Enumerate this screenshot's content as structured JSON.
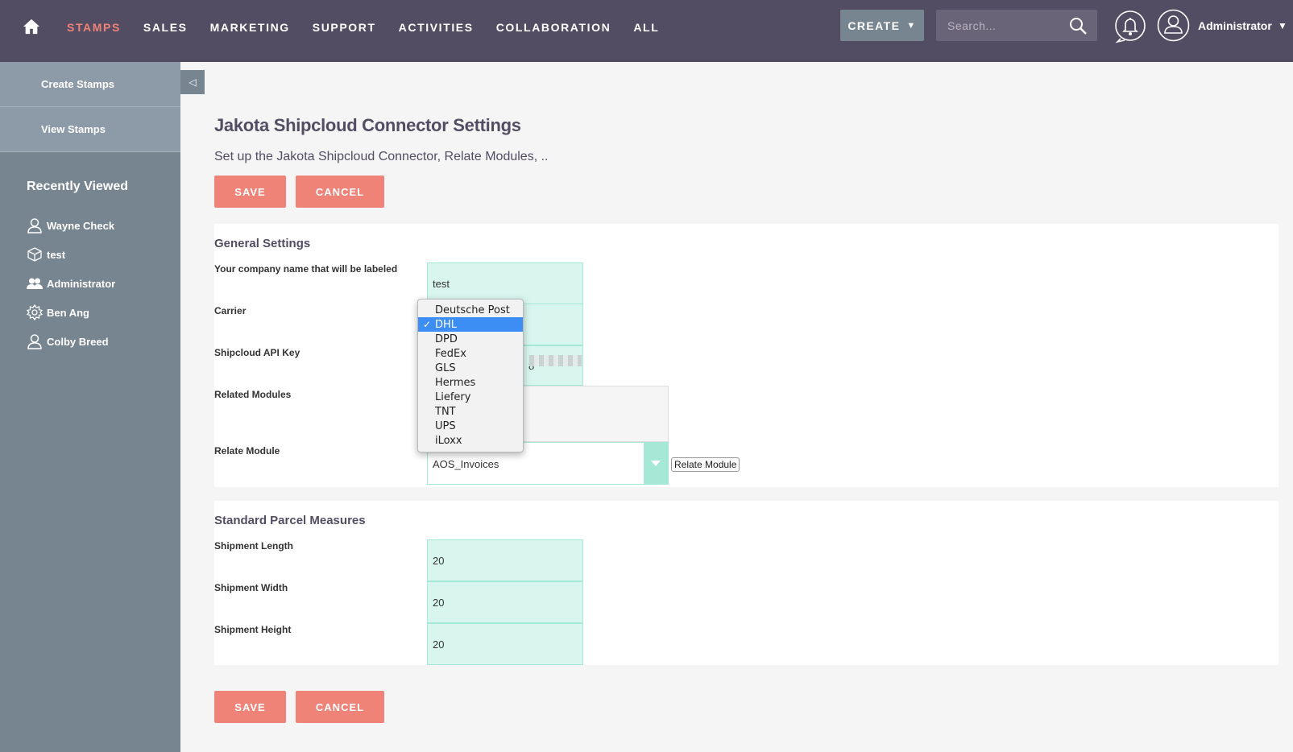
{
  "nav": {
    "links": [
      "STAMPS",
      "SALES",
      "MARKETING",
      "SUPPORT",
      "ACTIVITIES",
      "COLLABORATION",
      "ALL"
    ],
    "create_label": "CREATE",
    "search_placeholder": "Search...",
    "user_name": "Administrator"
  },
  "sidebar": {
    "actions": [
      "Create Stamps",
      "View Stamps"
    ],
    "recent_title": "Recently Viewed",
    "recent_items": [
      {
        "label": "Wayne Check",
        "icon": "contact-icon"
      },
      {
        "label": "test",
        "icon": "cube-icon"
      },
      {
        "label": "Administrator",
        "icon": "users-icon"
      },
      {
        "label": "Ben Ang",
        "icon": "gear-icon"
      },
      {
        "label": "Colby Breed",
        "icon": "contact-icon"
      }
    ]
  },
  "page": {
    "title": "Jakota Shipcloud Connector Settings",
    "subtitle": "Set up the Jakota Shipcloud Connector, Relate Modules, ..",
    "save_label": "SAVE",
    "cancel_label": "CANCEL"
  },
  "general": {
    "title": "General Settings",
    "company_label": "Your company name that will be labeled",
    "company_value": "test",
    "carrier_label": "Carrier",
    "api_key_label": "Shipcloud API Key",
    "api_key_visible": "8",
    "related_modules_label": "Related Modules",
    "relate_module_label": "Relate Module",
    "relate_module_value": "AOS_Invoices",
    "relate_module_button": "Relate Module"
  },
  "carrier_dropdown": {
    "options": [
      "Deutsche Post",
      "DHL",
      "DPD",
      "FedEx",
      "GLS",
      "Hermes",
      "Liefery",
      "TNT",
      "UPS",
      "iLoxx"
    ],
    "selected": "DHL",
    "check": "✓"
  },
  "parcel": {
    "title": "Standard Parcel Measures",
    "length_label": "Shipment Length",
    "length_value": "20",
    "width_label": "Shipment Width",
    "width_value": "20",
    "height_label": "Shipment Height",
    "height_value": "20"
  },
  "colors": {
    "topbar": "#534d64",
    "accent": "#f08377",
    "sidebar": "#778591",
    "input_bg": "#d8f5ee",
    "input_border": "#a5e8d6",
    "selected_option": "#3d8ef4"
  }
}
